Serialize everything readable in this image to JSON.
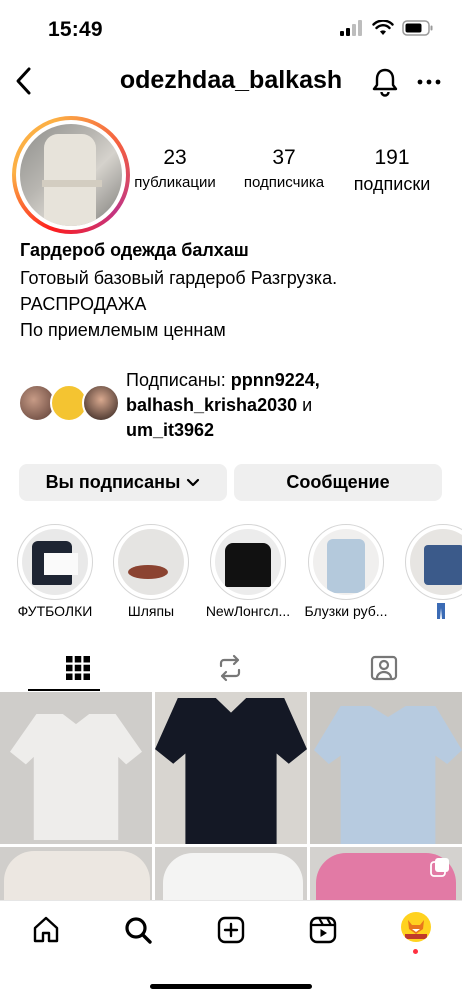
{
  "status_bar": {
    "time": "15:49"
  },
  "header": {
    "username": "odezhdaa_balkash"
  },
  "stats": [
    {
      "value": "23",
      "label": "публикации"
    },
    {
      "value": "37",
      "label": "подписчика"
    },
    {
      "value": "191",
      "label": "подписки"
    }
  ],
  "bio": {
    "name": "Гардероб одежда балхаш",
    "lines": [
      "Готовый базовый гардероб Разгрузка.",
      "РАСПРОДАЖА",
      "По приемлемым ценнам"
    ]
  },
  "followed_by": {
    "prefix": "Подписаны: ",
    "user1": "ppnn9224,",
    "user2": "balhash_krisha2030",
    "joiner": " и",
    "user3": "um_it3962"
  },
  "buttons": {
    "following": "Вы подписаны",
    "message": "Сообщение"
  },
  "highlights": [
    {
      "label": "ФУТБОЛКИ"
    },
    {
      "label": "Шляпы"
    },
    {
      "label": "NewЛонгсл..."
    },
    {
      "label": "Блузки руб..."
    }
  ],
  "colors": {
    "accent_gradient": [
      "#fcb045",
      "#fd1d1d",
      "#c13584"
    ],
    "button_bg": "#efefef",
    "notification_dot": "#ff3040"
  },
  "icons": {
    "back": "chevron-left-icon",
    "notifications": "bell-icon",
    "more": "more-horizontal-icon",
    "tab_grid": "grid-icon",
    "tab_reels": "repost-icon",
    "tab_tagged": "tagged-user-icon",
    "nav_home": "home-icon",
    "nav_search": "search-icon",
    "nav_create": "plus-square-icon",
    "nav_reels": "reels-icon",
    "nav_profile": "avatar"
  }
}
